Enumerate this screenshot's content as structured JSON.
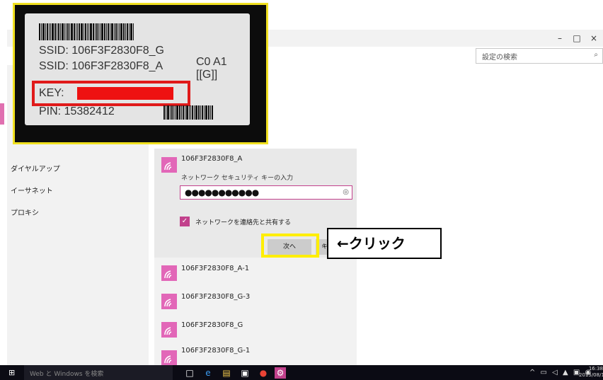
{
  "window": {
    "min_symbol": "–",
    "max_symbol": "□",
    "close_symbol": "×",
    "search_placeholder": "設定の検索"
  },
  "sidebar": {
    "items": [
      {
        "label": "ダイヤルアップ"
      },
      {
        "label": "イーサネット"
      },
      {
        "label": "プロキシ"
      }
    ]
  },
  "wifi": {
    "expanded": {
      "ssid": "106F3F2830F8_A",
      "key_label": "ネットワーク セキュリティ キーの入力",
      "key_value": "●●●●●●●●●●●",
      "share_label": "ネットワークを連絡先と共有する",
      "share_checked": true,
      "next_label": "次へ",
      "cancel_label": "キャンセル"
    },
    "networks": [
      {
        "ssid": "106F3F2830F8_A-1"
      },
      {
        "ssid": "106F3F2830F8_G-3"
      },
      {
        "ssid": "106F3F2830F8_G"
      },
      {
        "ssid": "106F3F2830F8_G-1"
      }
    ]
  },
  "annotation": {
    "callout": "←クリック"
  },
  "photo": {
    "line1": "SSID: 106F3F2830F8_G",
    "line2": "SSID: 106F3F2830F8_A",
    "line3": "KEY:",
    "line4": "PIN: 15382412",
    "right1": "C0 A1",
    "right2": "[[G]]"
  },
  "taskbar": {
    "search_placeholder": "Web と Windows を検索",
    "time": "16:38",
    "date": "2015/08/1"
  },
  "colors": {
    "accent": "#e267b8",
    "annotation_red": "#e01a1a",
    "annotation_yellow": "#ffee00"
  }
}
